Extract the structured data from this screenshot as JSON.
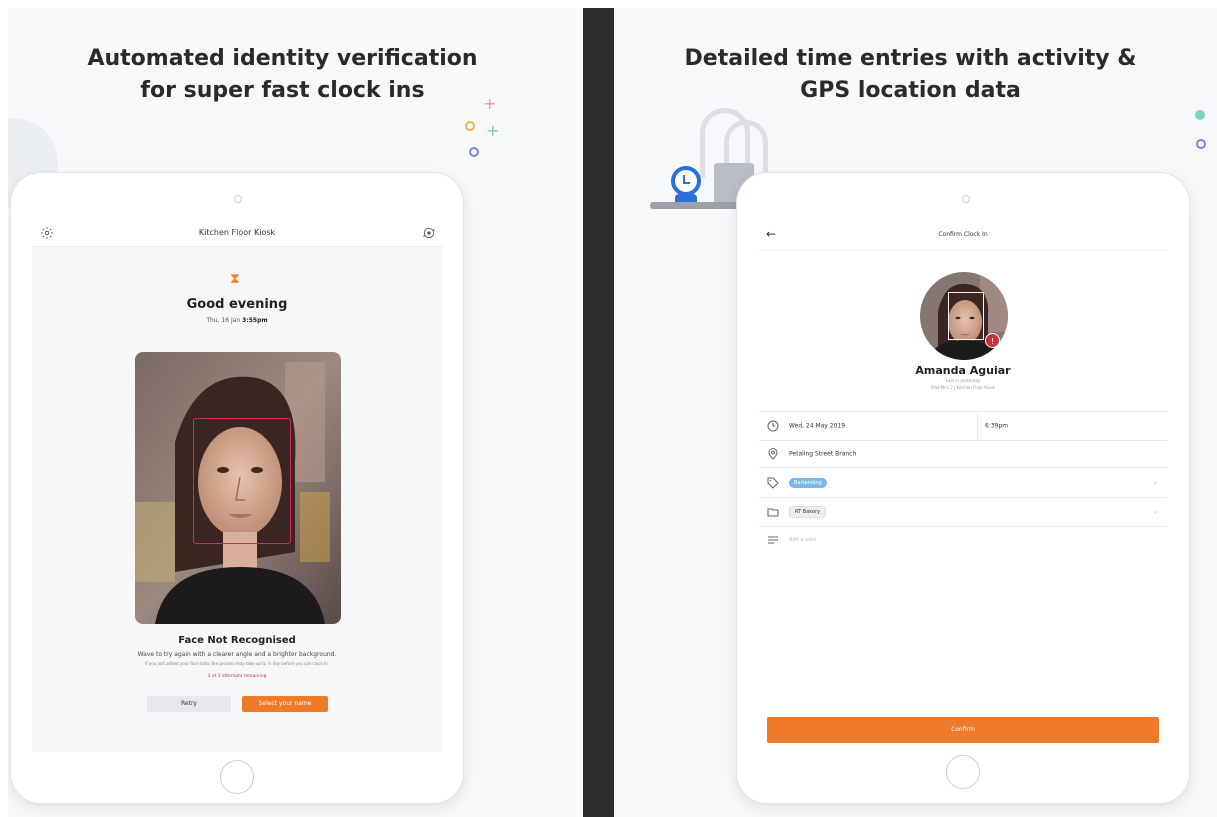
{
  "left": {
    "headline_line1": "Automated identity verification",
    "headline_line2": "for super fast clock ins",
    "kiosk_title": "Kitchen Floor Kiosk",
    "greeting": "Good evening",
    "date": "Thu, 16 Jan",
    "time": "3:55pm",
    "status_title": "Face Not Recognised",
    "status_message": "Wave to try again with a clearer angle and a brighter background.",
    "status_hint": "If you just added your face data, the process may take up to ½ day before you can clock in.",
    "attempts": "3 of 3 attempts remaining",
    "retry_label": "Retry",
    "select_name_label": "Select your name",
    "icons": [
      "gear-icon",
      "switch-camera-icon",
      "hourglass-icon"
    ]
  },
  "right": {
    "headline_line1": "Detailed time entries with activity &",
    "headline_line2": "GPS location data",
    "screen_title": "Confirm Clock In",
    "user_name": "Amanda Aguiar",
    "user_last_seen": "Last in yesterday",
    "user_device": "iPad Mini 2 | Kitchen Floor Kiosk",
    "date": "Wed, 24 May 2019",
    "time": "6:39pm",
    "location": "Petaling Street Branch",
    "activity_tag": "Bartending",
    "project_tag": "RT Bakery",
    "note_placeholder": "Add a note",
    "confirm_label": "Confirm",
    "icons": [
      "back-arrow-icon",
      "clock-icon",
      "location-pin-icon",
      "tag-icon",
      "folder-icon",
      "note-lines-icon",
      "alert-badge-icon"
    ]
  },
  "colors": {
    "accent": "#ef7a2a",
    "alert": "#c72f5f",
    "tag_blue": "#7db8e8",
    "background": "#f6f8fa",
    "divider": "#2c2d2f"
  }
}
